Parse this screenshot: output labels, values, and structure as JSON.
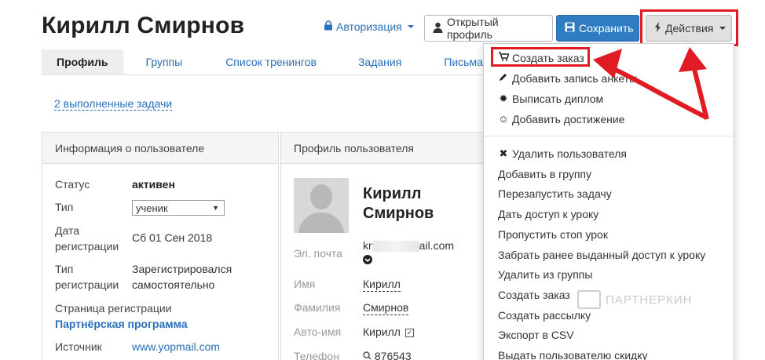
{
  "header": {
    "title": "Кирилл Смирнов",
    "auth_label": "Авторизация",
    "open_profile_label": "Открытый профиль",
    "save_label": "Сохранить",
    "actions_label": "Действия"
  },
  "tabs": [
    {
      "label": "Профиль"
    },
    {
      "label": "Группы"
    },
    {
      "label": "Список тренингов"
    },
    {
      "label": "Задания"
    },
    {
      "label": "Письма"
    }
  ],
  "tasks_link": "2 выполненные задачи",
  "info_panel": {
    "title": "Информация о пользователе",
    "status_label": "Статус",
    "status_value": "активен",
    "type_label": "Тип",
    "type_value": "ученик",
    "reg_date_label_1": "Дата",
    "reg_date_label_2": "регистрации",
    "reg_date_value": "Сб 01 Сен 2018",
    "reg_type_label_1": "Тип",
    "reg_type_label_2": "регистрации",
    "reg_type_value_1": "Зарегистрировался",
    "reg_type_value_2": "самостоятельно",
    "reg_page_label": "Страница регистрации",
    "reg_page_value": "Партнёрская программа",
    "source_label": "Источник",
    "source_value": "www.yopmail.com"
  },
  "profile_panel": {
    "title": "Профиль пользователя",
    "name_line_1": "Кирилл",
    "name_line_2": "Смирнов",
    "email_label": "Эл. почта",
    "email_prefix": "kr",
    "email_suffix": "ail.com",
    "first_name_label": "Имя",
    "first_name_value": "Кирилл",
    "last_name_label": "Фамилия",
    "last_name_value": "Смирнов",
    "auto_name_label": "Авто-имя",
    "auto_name_value": "Кирилл",
    "phone_label": "Телефон",
    "phone_value": "876543"
  },
  "actions_menu": {
    "group_1": [
      {
        "label": "Создать заказ",
        "icon": "cart-icon"
      },
      {
        "label": "Добавить запись анкеты",
        "icon": "pencil-icon"
      },
      {
        "label": "Выписать диплом",
        "icon": "certificate-icon"
      },
      {
        "label": "Добавить достижение",
        "icon": "smile-icon"
      }
    ],
    "group_2": [
      {
        "label": "Удалить пользователя",
        "icon": "close-icon"
      },
      {
        "label": "Добавить в группу"
      },
      {
        "label": "Перезапустить задачу"
      },
      {
        "label": "Дать доступ к уроку"
      },
      {
        "label": "Пропустить стоп урок"
      },
      {
        "label": "Забрать ранее выданный доступ к уроку"
      },
      {
        "label": "Удалить из группы"
      },
      {
        "label": "Создать заказ"
      },
      {
        "label": "Создать рассылку"
      },
      {
        "label": "Экспорт в CSV"
      },
      {
        "label": "Выдать пользователю скидку"
      }
    ]
  },
  "watermark": "ПАРТНЕРКИН",
  "colors": {
    "accent": "#2a6fb8",
    "save_button": "#2f7cc1",
    "annotation_red": "#e01b24"
  }
}
